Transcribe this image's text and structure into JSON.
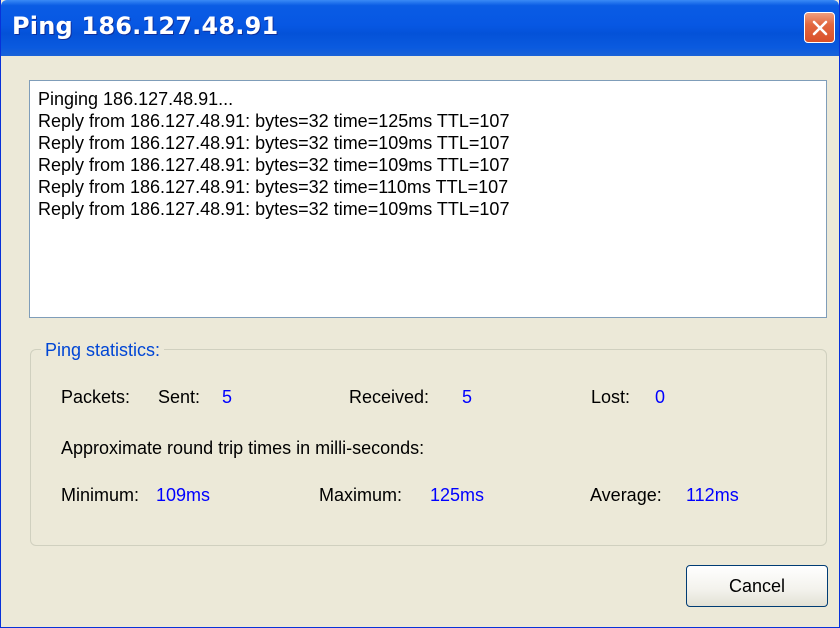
{
  "window": {
    "title": "Ping 186.127.48.91"
  },
  "output": {
    "lines": [
      "Pinging 186.127.48.91...",
      "Reply from 186.127.48.91: bytes=32 time=125ms TTL=107",
      "Reply from 186.127.48.91: bytes=32 time=109ms TTL=107",
      "Reply from 186.127.48.91: bytes=32 time=109ms TTL=107",
      "Reply from 186.127.48.91: bytes=32 time=110ms TTL=107",
      "Reply from 186.127.48.91: bytes=32 time=109ms TTL=107"
    ]
  },
  "statistics": {
    "caption": "Ping statistics:",
    "packets_label": "Packets:",
    "sent_label": "Sent:",
    "sent_value": "5",
    "received_label": "Received:",
    "received_value": "5",
    "lost_label": "Lost:",
    "lost_value": "0",
    "rtt_caption": "Approximate round trip times in milli-seconds:",
    "minimum_label": "Minimum:",
    "minimum_value": "109ms",
    "maximum_label": "Maximum:",
    "maximum_value": "125ms",
    "average_label": "Average:",
    "average_value": "112ms"
  },
  "buttons": {
    "cancel_label": "Cancel"
  },
  "colors": {
    "titlebar": "#0757e3",
    "dialog_background": "#ece9d8",
    "value_text": "#0000ff",
    "group_caption": "#0046d5"
  },
  "icons": {
    "close": "close-icon"
  }
}
